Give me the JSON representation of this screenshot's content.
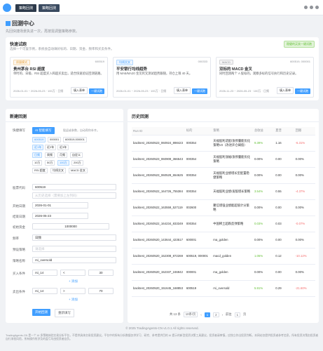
{
  "header": {
    "tabs": [
      "策略回测",
      "策略回测"
    ]
  },
  "page": {
    "title": "回测中心",
    "subtitle": "先回快捷场景执进一次，再按需调整策略参数。"
  },
  "quick": {
    "title": "快速试跑",
    "subtitle": "选择一个可复示例，系统会自动填好标的、日期、资金、频率和买卖条件。",
    "tag": "稳健的买卖一键试跑",
    "templates": [
      {
        "tag": "质量模式",
        "tag_color": "#e6a23c",
        "id": "600519",
        "name": "贵州茅台 RSI 超度",
        "desc": "单时的、日级、RSI 超度买入和超买卖出，适合快速验证回测链路。",
        "meta": "2026-01-01 ~ 2026-05-23 · 100万 · 日频",
        "btn1": "填入表单",
        "btn2": "一键试跑"
      },
      {
        "tag": "均线交叉",
        "tag_color": "#409eff",
        "id": "000333",
        "name": "平安银行均线趋势",
        "desc": "用 MA5/MA20 金叉死叉测试趋势跟随，持仓上限 40 天。",
        "meta": "2026-01-01 ~ 2026-05-23 · 100万 · 日频",
        "btn1": "填入表单",
        "btn2": "一键试跑"
      },
      {
        "tag": "MACD",
        "tag_color": "#909399",
        "id": "600519, 000001",
        "name": "双标的 MACD 金叉",
        "desc": "同时回测两个 A 股标的，观察多标的信号执行和历史记录。",
        "meta": "2026-11-23 ~ 2026-05-23 · 100万 · 日频",
        "btn1": "填入表单",
        "btn2": "一键试跑"
      }
    ]
  },
  "form": {
    "title": "新建回测",
    "quick_label": "快捷填写",
    "ai_btn": "AI 智能填写",
    "ai_hint": "股返或参数，自动帮你补齐。",
    "chips_row1": [
      "600519",
      "000001",
      "600519,000001"
    ],
    "chips_row2": [
      "近1年",
      "近2年",
      "近3年"
    ],
    "chips_row3": [
      "日频",
      "周频",
      "月频",
      "自定义"
    ],
    "chips_row4": [
      "10万",
      "50万",
      "100万",
      "200万"
    ],
    "chips_row5": [
      "RSI 超度",
      "均线交叉",
      "MACD 金叉"
    ],
    "code_label": "股票代码",
    "code_value": "600519",
    "code_hint": "从历史选择（需要加上左列码）",
    "start_label": "开始日期",
    "start_value": "2026-01-01",
    "end_label": "结束日期",
    "end_value": "2026-05-23",
    "capital_label": "初始资金",
    "capital_value": "1000000",
    "freq_label": "频率",
    "freq_value": "日频",
    "strategy_label": "预设策略",
    "strategy_value": "请选择",
    "name_label": "策略名称",
    "name_value": "rsi_oversold",
    "buy_label": "买入条件",
    "buy_ind": "rsi_14",
    "buy_op": "<",
    "buy_val": "30",
    "sell_label": "卖出条件",
    "sell_ind": "rsi_14",
    "sell_op": ">",
    "sell_val": "70",
    "add_label": "+ 添加",
    "run_btn": "开始回测",
    "reset_btn": "重新填写"
  },
  "history": {
    "title": "历史回测",
    "columns": [
      "Run ID",
      "标的",
      "策略",
      "总收益",
      "夏普",
      "回撤"
    ],
    "rows": [
      {
        "id": "backtest_20260523_060924_898423",
        "code": "000354",
        "strategy": "天福股利适配/涨停量能优化策略V2（改进开仓阈值）",
        "ret": "9.39%",
        "sharpe": "1.16",
        "dd": "-6.31%"
      },
      {
        "id": "backtest_20260523_060909_366543",
        "code": "000354",
        "strategy": "天福股利涨幅/涨停量能优化策略",
        "ret": "0.00%",
        "sharpe": "0.00",
        "dd": "0.00%"
      },
      {
        "id": "backtest_20260523_060529_654625",
        "code": "000354",
        "strategy": "天福股利业绩增长型配置稳健策略",
        "ret": "0.00%",
        "sharpe": "0.00",
        "dd": "0.00%"
      },
      {
        "id": "backtest_20260522_164726_755384",
        "code": "000354",
        "strategy": "天福股利业绩/发版增长策略",
        "ret": "3.54%",
        "sharpe": "0.55",
        "dd": "-4.37%"
      },
      {
        "id": "backtest_20260522_163559_527119",
        "code": "002600",
        "strategy": "聚信增强业绩能超值计分策略",
        "ret": "0.00%",
        "sharpe": "0.00",
        "dd": "0.00%"
      },
      {
        "id": "backtest_20260522_164234_833349",
        "code": "000354",
        "strategy": "中国稀土超跌反弹策略",
        "ret": "0.03%",
        "sharpe": "0.03",
        "dd": "-0.07%"
      },
      {
        "id": "backtest_20260520_143644_423517",
        "code": "600001",
        "strategy": "ma_golden",
        "ret": "0.00%",
        "sharpe": "0.00",
        "dd": "0.00%"
      },
      {
        "id": "backtest_20260520_152308_872269",
        "code": "600519, 000001",
        "strategy": "macd_golden",
        "ret": "1.05%",
        "sharpe": "0.12",
        "dd": "-10.12%"
      },
      {
        "id": "backtest_20260520_152337_246942",
        "code": "000001",
        "strategy": "ma_golden",
        "ret": "0.00%",
        "sharpe": "0.00",
        "dd": "0.00%"
      },
      {
        "id": "backtest_20260520_151645_168853",
        "code": "600519",
        "strategy": "rsi_oversold",
        "ret": "5.91%",
        "sharpe": "0.29",
        "dd": "-21.60%"
      }
    ],
    "pager": {
      "total": "共 13 条",
      "size": "10条/页",
      "pages": [
        "1",
        "2"
      ],
      "goto": "前往",
      "goto_page": "1",
      "page_unit": "页"
    }
  },
  "footer": {
    "copyright": "© 2025 TradingAgents-CN v1.0.1 All rights reserved.",
    "disclaimer": "TradingAgents-CN 是一个 AI 多策略体验交易分析平台，不提供具体交易投资建议。平台中的所有分析数据仅供学习、研究、参考提供目的 AI 提示的新型投资决策工具建议，投资者请审慎，应独立作出投资判断。本网站仅提供投资者参考信息，所有投资决策由投资者自行承担风险，所有操作所涉及的盈亏均由投资者自负。"
  },
  "colors": {
    "primary": "#409eff",
    "positive": "#67c23a",
    "negative": "#f56c6c"
  }
}
